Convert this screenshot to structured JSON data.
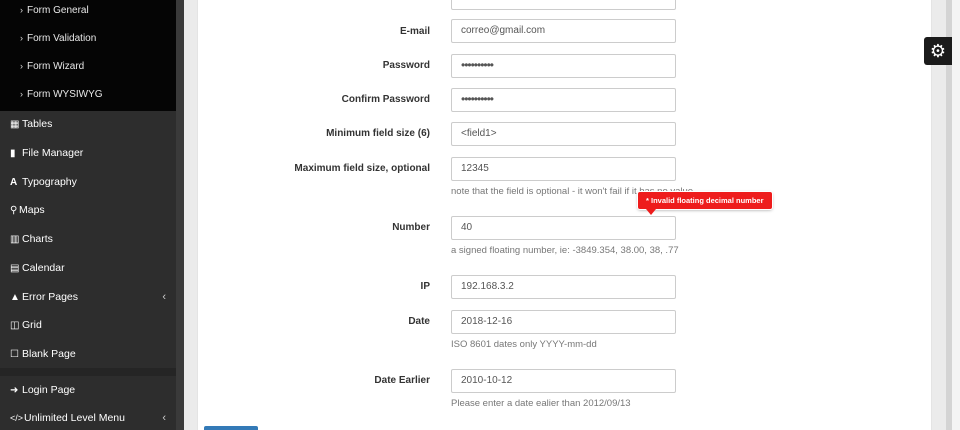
{
  "sidebar": {
    "submenu": [
      {
        "label": "Form General"
      },
      {
        "label": "Form Validation"
      },
      {
        "label": "Form Wizard"
      },
      {
        "label": "Form WYSIWYG"
      }
    ],
    "items": [
      {
        "label": "Tables",
        "icon": "table-icon"
      },
      {
        "label": "File Manager",
        "icon": "file-icon"
      },
      {
        "label": "Typography",
        "icon": "font-icon"
      },
      {
        "label": "Maps",
        "icon": "map-marker-icon"
      },
      {
        "label": "Charts",
        "icon": "bar-chart-icon"
      },
      {
        "label": "Calendar",
        "icon": "calendar-icon"
      },
      {
        "label": "Error Pages",
        "icon": "warning-icon"
      },
      {
        "label": "Grid",
        "icon": "grid-icon"
      },
      {
        "label": "Blank Page",
        "icon": "square-icon"
      },
      {
        "label": "Login Page",
        "icon": "sign-in-icon"
      },
      {
        "label": "Unlimited Level Menu",
        "icon": "code-icon"
      }
    ]
  },
  "form": {
    "email": {
      "label": "E-mail",
      "value": "correo@gmail.com"
    },
    "password": {
      "label": "Password",
      "value": "••••••••••"
    },
    "confirm_password": {
      "label": "Confirm Password",
      "value": "••••••••••"
    },
    "min_field": {
      "label": "Minimum field size (6)",
      "value": "<field1>"
    },
    "max_field": {
      "label": "Maximum field size, optional",
      "value": "12345",
      "help": "note that the field is optional - it won't fail if it has no value"
    },
    "number": {
      "label": "Number",
      "value": "40",
      "help": "a signed floating number, ie: -3849.354, 38.00, 38, .77",
      "error": "* Invalid floating decimal number"
    },
    "ip": {
      "label": "IP",
      "value": "192.168.3.2"
    },
    "date": {
      "label": "Date",
      "value": "2018-12-16",
      "help": "ISO 8601 dates only YYYY-mm-dd"
    },
    "date_earlier": {
      "label": "Date Earlier",
      "value": "2010-10-12",
      "help": "Please enter a date ealier than 2012/09/13"
    }
  },
  "colors": {
    "sidebar_bg": "#2d2d2d",
    "submenu_bg": "#050505",
    "error_red": "#ee1c1c",
    "primary_blue": "#337ab7"
  }
}
